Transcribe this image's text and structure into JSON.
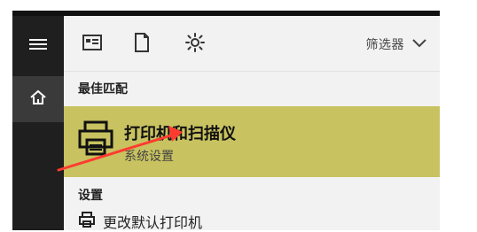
{
  "toolbar": {
    "filter_label": "筛选器",
    "icons": [
      "document-icon",
      "file-icon",
      "gear-icon",
      "chevron-down-icon"
    ]
  },
  "sidebar": {
    "icons": [
      "menu-icon",
      "home-icon"
    ]
  },
  "sections": {
    "best_match": "最佳匹配",
    "settings": "设置"
  },
  "result": {
    "title": "打印机和扫描仪",
    "subtitle": "系统设置"
  },
  "next_item": {
    "label": "更改默认打印机"
  },
  "colors": {
    "accent_highlight": "#c8c260",
    "rail_bg": "#1f1f1f",
    "panel_bg": "#f2f2f2",
    "arrow": "#ff3b2f"
  }
}
